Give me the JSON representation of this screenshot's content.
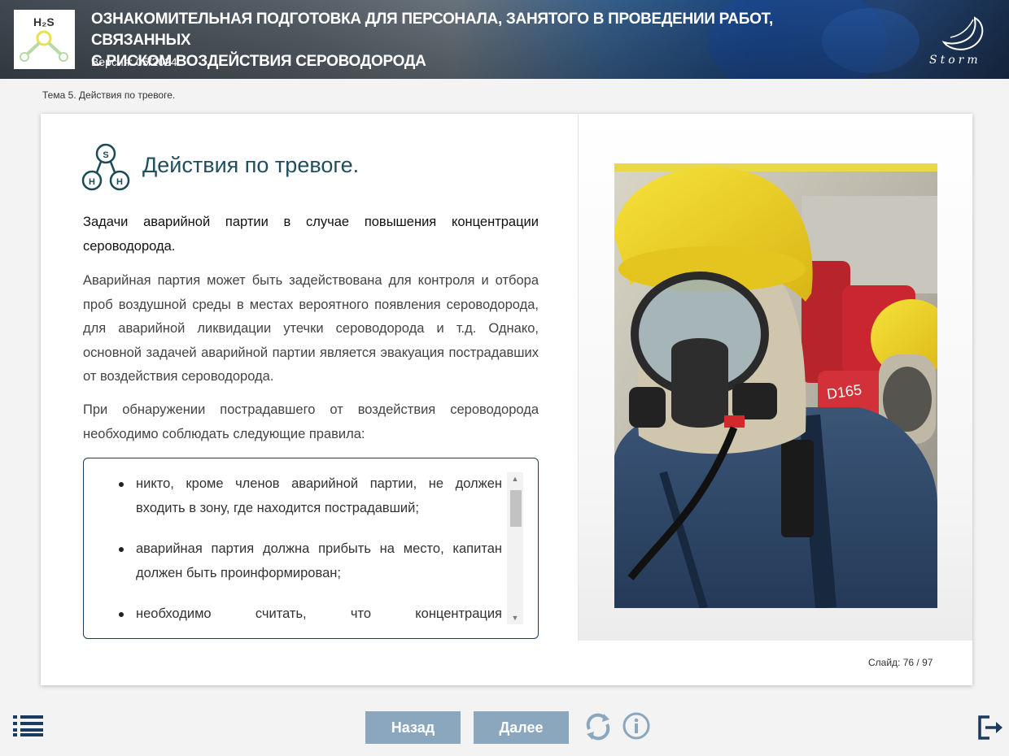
{
  "header": {
    "title_line1": "ОЗНАКОМИТЕЛЬНАЯ ПОДГОТОВКА ДЛЯ ПЕРСОНАЛА, ЗАНЯТОГО В ПРОВЕДЕНИИ РАБОТ, СВЯЗАННЫХ",
    "title_line2": "С РИСКОМ ВОЗДЕЙСТВИЯ СЕРОВОДОРОДА",
    "version": "Версия: 05/2024",
    "logo_formula": "H₂S",
    "brand": "Storm"
  },
  "breadcrumb": "Тема 5. Действия по тревоге.",
  "slide": {
    "heading": "Действия по тревоге.",
    "icon_letters": {
      "top": "S",
      "left": "H",
      "right": "H"
    },
    "subheading": "Задачи аварийной партии в случае повышения концентрации сероводорода.",
    "paragraph1": "Аварийная партия может быть задействована для контроля и отбора проб воздушной среды в местах вероятного появления сероводорода, для аварийной ликвидации утечки сероводорода и т.д. Однако, основной задачей аварийной партии является эвакуация пострадавших от воздействия сероводорода.",
    "paragraph2": "При обнаружении пострадавшего от воздействия сероводорода необходимо соблюдать следующие правила:",
    "rules": [
      "никто, кроме членов аварийной партии,  не должен входить в зону, где находится пострадавший;",
      "аварийная партия должна прибыть на место, капитан должен быть проинформирован;",
      "необходимо считать, что концентрация"
    ],
    "photo_label": "D165"
  },
  "counter": {
    "label": "Слайд:",
    "value": "76 / 97"
  },
  "footer": {
    "back_label": "Назад",
    "next_label": "Далее"
  },
  "colors": {
    "heading": "#1f4e5e",
    "nav_button": "#8aa7bd",
    "rules_border": "#1c3a5c",
    "icon_teal": "#1b4a55"
  }
}
